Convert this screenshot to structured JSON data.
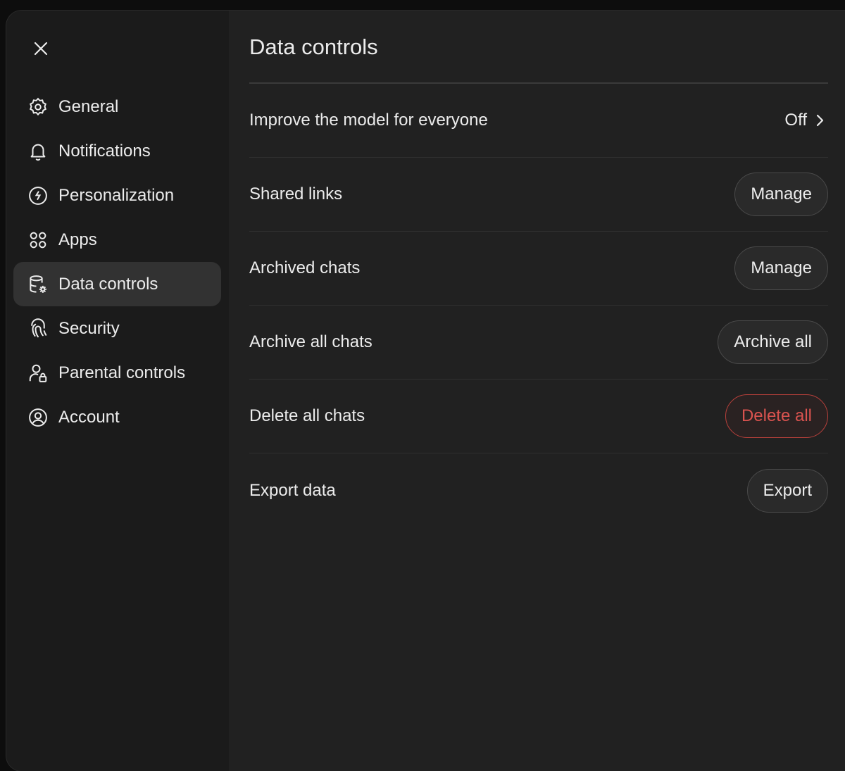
{
  "colors": {
    "background": "#212121",
    "sidebar": "#1b1b1b",
    "active_item": "#323232",
    "danger": "#d9534f"
  },
  "close": {
    "icon": "close-icon"
  },
  "sidebar": {
    "items": [
      {
        "label": "General",
        "icon": "gear-icon"
      },
      {
        "label": "Notifications",
        "icon": "bell-icon"
      },
      {
        "label": "Personalization",
        "icon": "personalization-icon"
      },
      {
        "label": "Apps",
        "icon": "apps-grid-icon"
      },
      {
        "label": "Data controls",
        "icon": "database-gear-icon",
        "active": true
      },
      {
        "label": "Security",
        "icon": "fingerprint-icon"
      },
      {
        "label": "Parental controls",
        "icon": "user-lock-icon"
      },
      {
        "label": "Account",
        "icon": "user-circle-icon"
      }
    ]
  },
  "main": {
    "title": "Data controls",
    "rows": [
      {
        "label": "Improve the model for everyone",
        "value": "Off",
        "icon": "chevron-right-icon"
      },
      {
        "label": "Shared links",
        "button": "Manage"
      },
      {
        "label": "Archived chats",
        "button": "Manage"
      },
      {
        "label": "Archive all chats",
        "button": "Archive all"
      },
      {
        "label": "Delete all chats",
        "button": "Delete all",
        "danger": true
      },
      {
        "label": "Export data",
        "button": "Export"
      }
    ]
  }
}
